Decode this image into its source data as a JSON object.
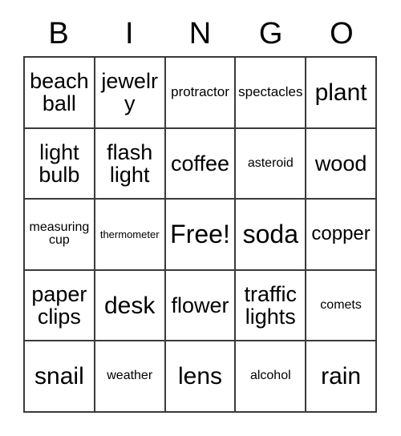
{
  "card": {
    "title": "BINGO",
    "headers": [
      "B",
      "I",
      "N",
      "G",
      "O"
    ],
    "free_space_label": "Free!",
    "colors": {
      "background": "#ffffff",
      "text": "#000000",
      "grid_line": "#3a3a3a"
    },
    "rows": [
      [
        {
          "label": "beach ball",
          "size": "md"
        },
        {
          "label": "jewelry",
          "size": "md"
        },
        {
          "label": "protractor",
          "size": "xs"
        },
        {
          "label": "spectacles",
          "size": "xs"
        },
        {
          "label": "plant",
          "size": "lg"
        }
      ],
      [
        {
          "label": "light bulb",
          "size": "md"
        },
        {
          "label": "flash light",
          "size": "md"
        },
        {
          "label": "coffee",
          "size": "md"
        },
        {
          "label": "asteroid",
          "size": "xxs"
        },
        {
          "label": "wood",
          "size": "md"
        }
      ],
      [
        {
          "label": "measuring cup",
          "size": "xxs"
        },
        {
          "label": "thermometer",
          "size": "tiny"
        },
        {
          "label": "Free!",
          "size": "xl"
        },
        {
          "label": "soda",
          "size": "xl"
        },
        {
          "label": "copper",
          "size": "sm"
        }
      ],
      [
        {
          "label": "paper clips",
          "size": "md"
        },
        {
          "label": "desk",
          "size": "lg"
        },
        {
          "label": "flower",
          "size": "md"
        },
        {
          "label": "traffic lights",
          "size": "md"
        },
        {
          "label": "comets",
          "size": "xxs"
        }
      ],
      [
        {
          "label": "snail",
          "size": "lg"
        },
        {
          "label": "weather",
          "size": "xxs"
        },
        {
          "label": "lens",
          "size": "lg"
        },
        {
          "label": "alcohol",
          "size": "xxs"
        },
        {
          "label": "rain",
          "size": "lg"
        }
      ]
    ]
  }
}
